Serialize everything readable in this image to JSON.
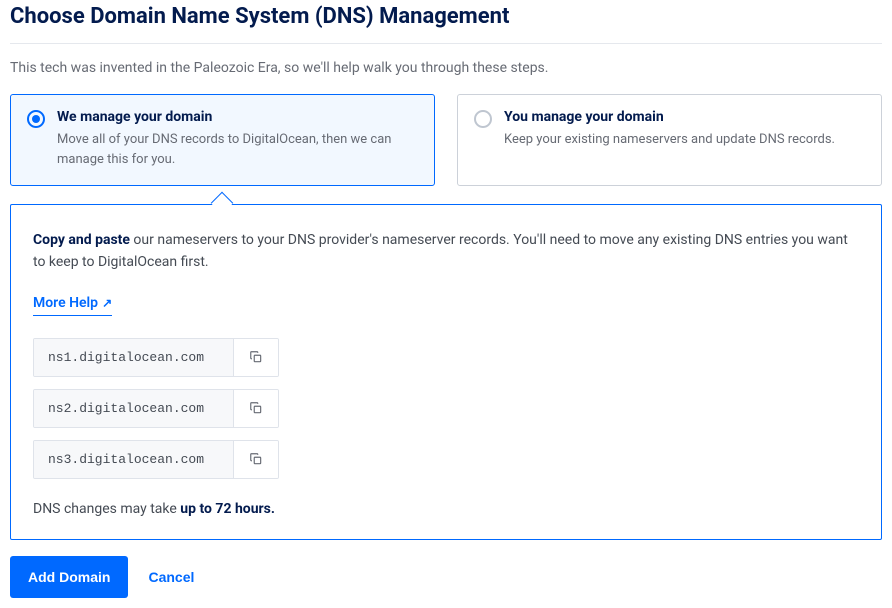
{
  "page_title": "Choose Domain Name System (DNS) Management",
  "intro_text": "This tech was invented in the Paleozoic Era, so we'll help walk you through these steps.",
  "options": [
    {
      "title": "We manage your domain",
      "description": "Move all of your DNS records to DigitalOcean, then we can manage this for you.",
      "selected": true
    },
    {
      "title": "You manage your domain",
      "description": "Keep your existing nameservers and update DNS records.",
      "selected": false
    }
  ],
  "instruction": {
    "lead_strong": "Copy and paste",
    "rest": " our nameservers to your DNS provider's nameserver records. You'll need to move any existing DNS entries you want to keep to DigitalOcean first."
  },
  "more_help_label": "More Help",
  "nameservers": [
    "ns1.digitalocean.com",
    "ns2.digitalocean.com",
    "ns3.digitalocean.com"
  ],
  "footnote": {
    "prefix": "DNS changes may take ",
    "strong": "up to 72 hours."
  },
  "actions": {
    "primary": "Add Domain",
    "cancel": "Cancel"
  }
}
